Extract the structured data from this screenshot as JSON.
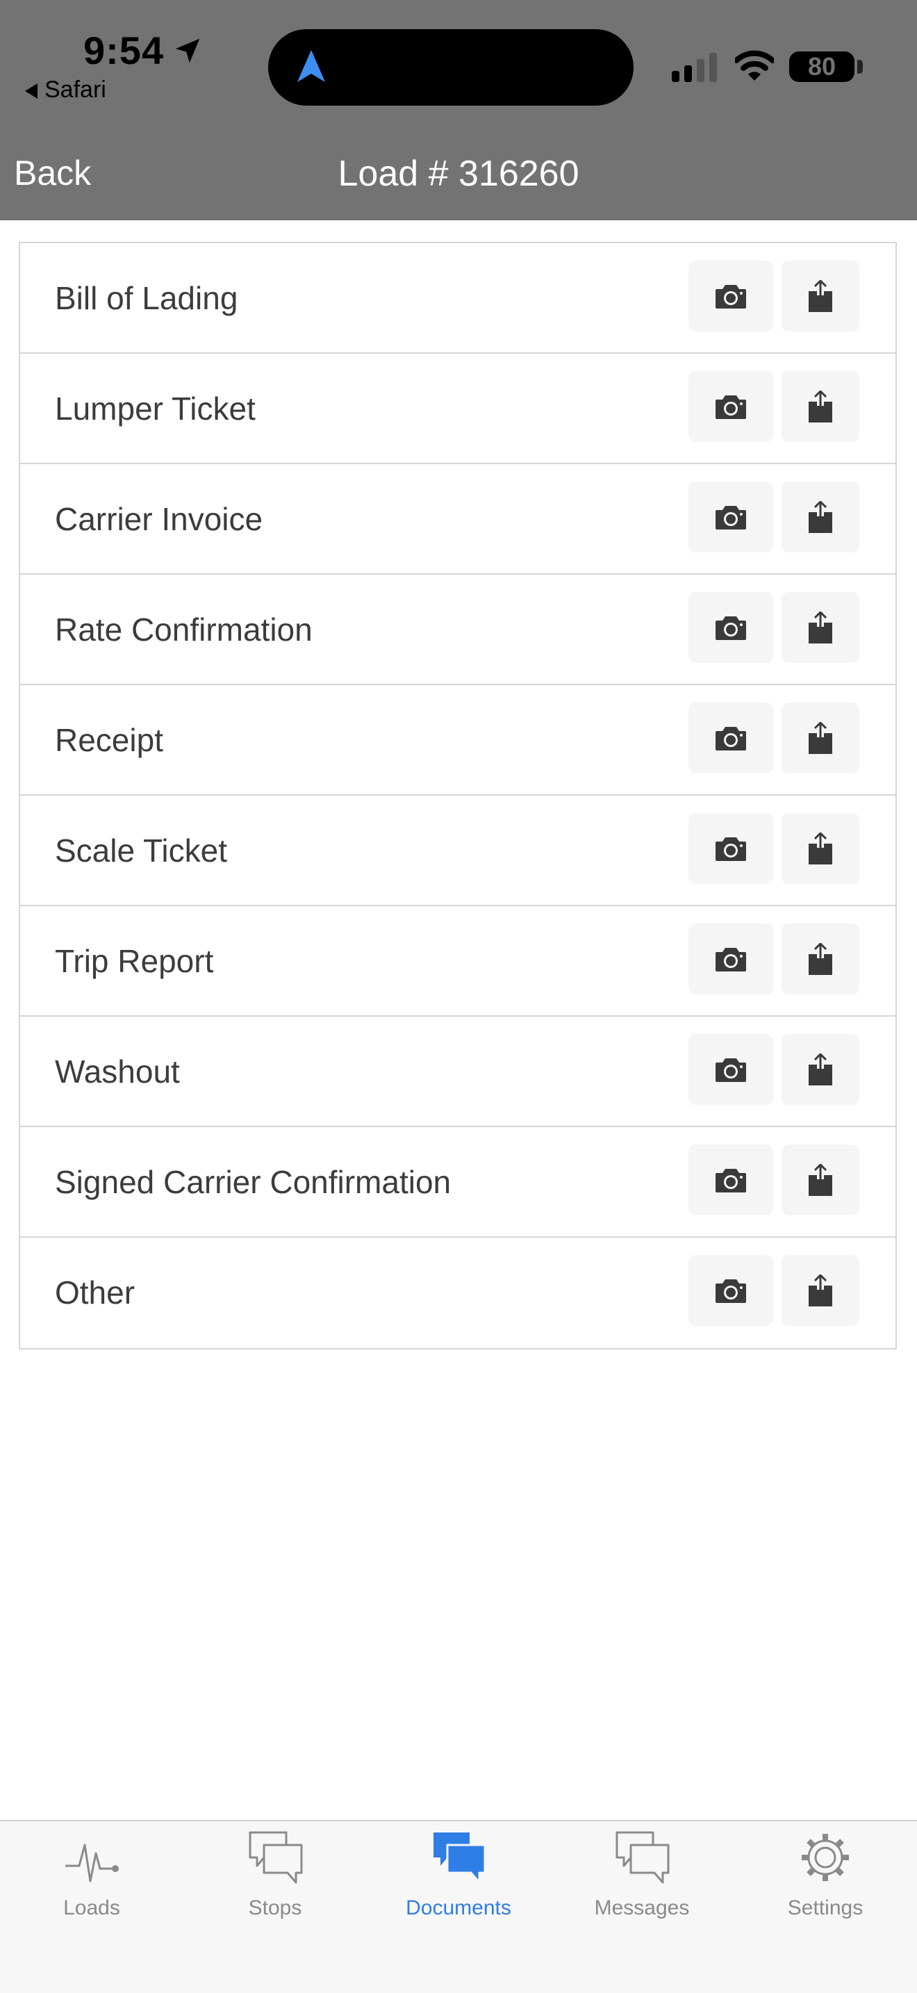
{
  "status_bar": {
    "time": "9:54",
    "back_app": "Safari",
    "battery": "80"
  },
  "nav": {
    "back_label": "Back",
    "title": "Load # 316260"
  },
  "documents": [
    {
      "label": "Bill of Lading"
    },
    {
      "label": "Lumper Ticket"
    },
    {
      "label": "Carrier Invoice"
    },
    {
      "label": "Rate Confirmation"
    },
    {
      "label": "Receipt"
    },
    {
      "label": "Scale Ticket"
    },
    {
      "label": "Trip Report"
    },
    {
      "label": "Washout"
    },
    {
      "label": "Signed Carrier Confirmation"
    },
    {
      "label": "Other"
    }
  ],
  "icons": {
    "row_actions": [
      "camera-icon",
      "upload-icon"
    ]
  },
  "tabs": [
    {
      "label": "Loads",
      "icon": "loads-pulse-icon",
      "active": false
    },
    {
      "label": "Stops",
      "icon": "stops-chat-icon",
      "active": false
    },
    {
      "label": "Documents",
      "icon": "documents-chat-icon",
      "active": true
    },
    {
      "label": "Messages",
      "icon": "messages-chat-icon",
      "active": false
    },
    {
      "label": "Settings",
      "icon": "settings-gear-icon",
      "active": false
    }
  ],
  "colors": {
    "header_bg": "#737373",
    "accent": "#2f7ee6",
    "tab_inactive": "#8a8a8a",
    "row_border": "#d6d6d6",
    "button_bg": "#f5f5f5"
  }
}
